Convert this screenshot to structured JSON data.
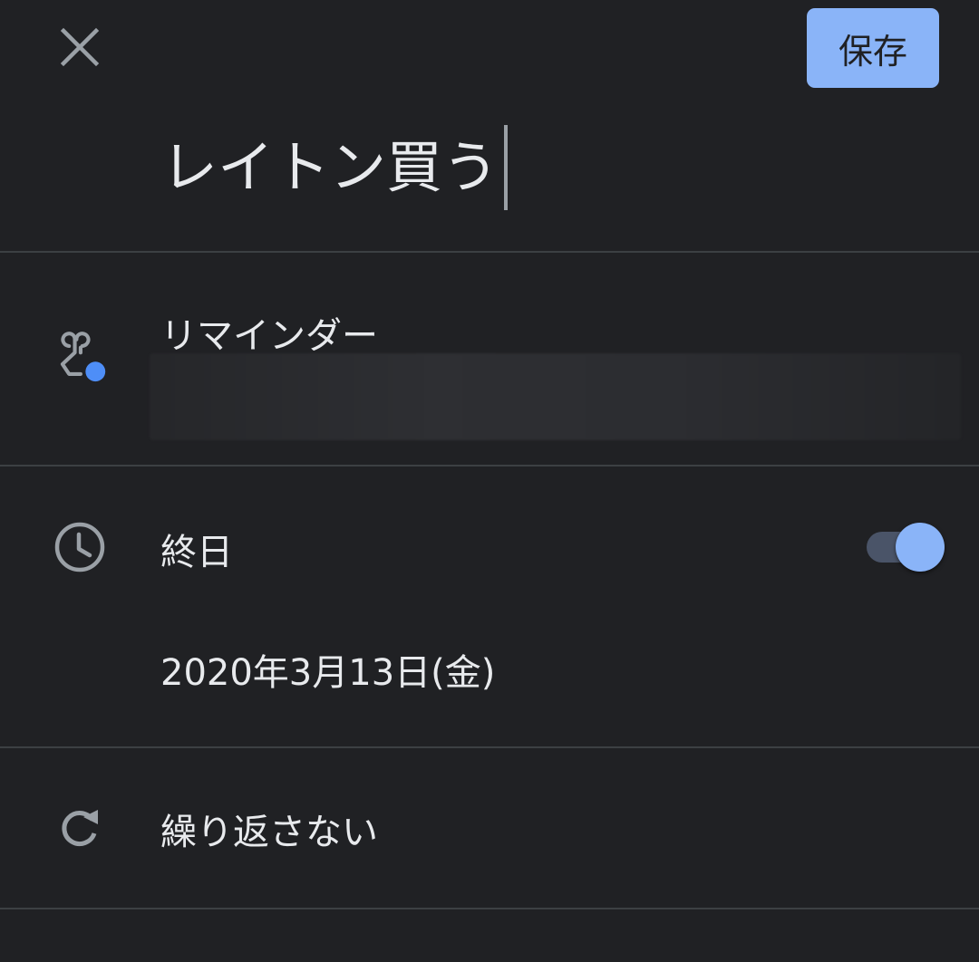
{
  "header": {
    "close_icon": "close-icon",
    "save_label": "保存"
  },
  "task": {
    "title": "レイトン買う"
  },
  "reminder": {
    "icon": "hand-tap-icon",
    "label": "リマインダー"
  },
  "all_day": {
    "icon": "clock-icon",
    "label": "終日",
    "enabled": true,
    "date": "2020年3月13日(金)"
  },
  "repeat": {
    "icon": "refresh-icon",
    "label": "繰り返さない"
  },
  "colors": {
    "background": "#202124",
    "accent": "#8ab4f8",
    "text": "#e8eaed",
    "icon": "#9aa0a6",
    "divider": "#3c4043",
    "reminder_dot": "#4e8ef7"
  }
}
